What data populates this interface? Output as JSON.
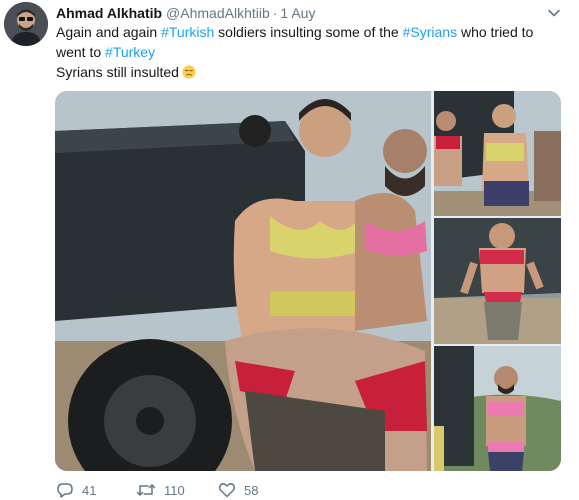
{
  "tweet": {
    "author_name": "Ahmad Alkhatib",
    "author_handle": "@AhmadAlkhtiib",
    "separator": "·",
    "timestamp": "1 Auy",
    "text": {
      "l1_a": "Again and again ",
      "l1_tag": "#Turkish",
      "l1_b": " soldiers insulting some of the ",
      "l1_tag2": "#Syrians",
      "l1_c": " who tried to",
      "l2_a": "went to ",
      "l2_tag": "#Turkey",
      "l3_a": "Syrians still insulted"
    },
    "emoji": "disappointed-face",
    "media_count": 4
  },
  "actions": {
    "replies": "41",
    "retweets": "110",
    "likes": "58"
  },
  "colors": {
    "link": "#1da1f2",
    "secondary": "#657786",
    "text": "#14171a"
  }
}
